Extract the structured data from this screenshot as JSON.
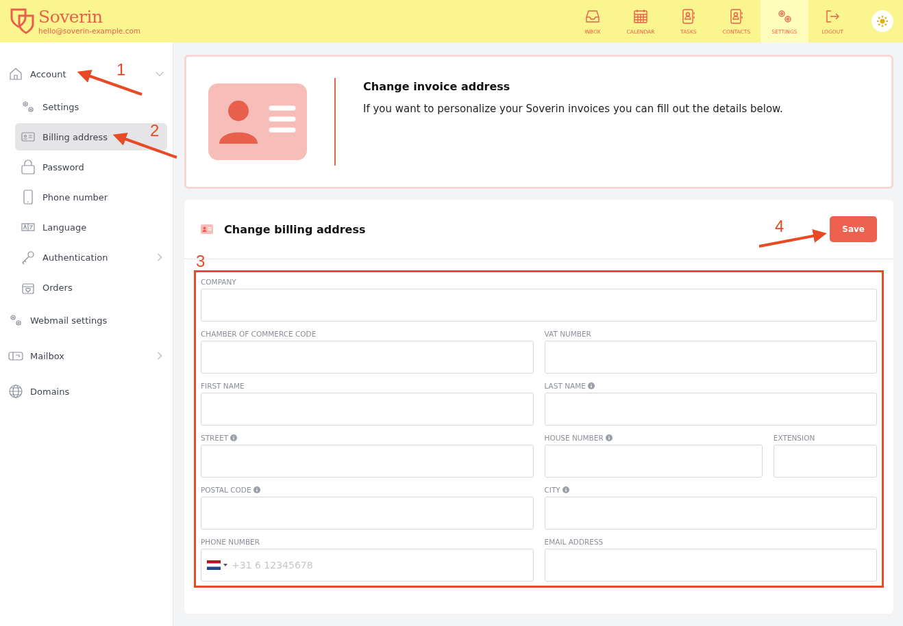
{
  "header": {
    "brand": "Soverin",
    "email": "hello@soverin-example.com",
    "nav": [
      {
        "label": "INBOX",
        "selected": false
      },
      {
        "label": "CALENDAR",
        "selected": false
      },
      {
        "label": "TASKS",
        "selected": false
      },
      {
        "label": "CONTACTS",
        "selected": false
      },
      {
        "label": "SETTINGS",
        "selected": true
      },
      {
        "label": "LOGOUT",
        "selected": false
      }
    ]
  },
  "sidebar": {
    "items": [
      {
        "label": "Account",
        "selected": false,
        "expanded": true,
        "children": [
          {
            "label": "Settings",
            "selected": false
          },
          {
            "label": "Billing address",
            "selected": true
          },
          {
            "label": "Password",
            "selected": false
          },
          {
            "label": "Phone number",
            "selected": false
          },
          {
            "label": "Language",
            "selected": false
          },
          {
            "label": "Authentication",
            "selected": false,
            "expanded": false
          },
          {
            "label": "Orders",
            "selected": false
          }
        ]
      },
      {
        "label": "Webmail settings",
        "selected": false
      },
      {
        "label": "Mailbox",
        "selected": false,
        "expanded": false
      },
      {
        "label": "Domains",
        "selected": false
      }
    ]
  },
  "intro": {
    "title": "Change invoice address",
    "text": "If you want to personalize your Soverin invoices you can fill out the details below."
  },
  "form": {
    "title": "Change billing address",
    "save": "Save",
    "rows": [
      [
        {
          "label": "COMPANY",
          "info": false,
          "kind": "text"
        }
      ],
      [
        {
          "label": "CHAMBER OF COMMERCE CODE",
          "info": false,
          "kind": "text"
        },
        {
          "label": "VAT NUMBER",
          "info": false,
          "kind": "text"
        }
      ],
      [
        {
          "label": "FIRST NAME",
          "info": false,
          "kind": "text"
        },
        {
          "label": "LAST NAME",
          "info": true,
          "kind": "text"
        }
      ],
      [
        {
          "label": "STREET",
          "info": true,
          "kind": "text"
        },
        {
          "label": "HOUSE NUMBER",
          "info": true,
          "kind": "text"
        },
        {
          "label": "EXTENSION",
          "info": false,
          "kind": "text"
        }
      ],
      [
        {
          "label": "POSTAL CODE",
          "info": true,
          "kind": "text"
        },
        {
          "label": "CITY",
          "info": true,
          "kind": "text"
        }
      ],
      [
        {
          "label": "PHONE NUMBER",
          "info": false,
          "kind": "phone",
          "placeholder": "+31 6 12345678"
        },
        {
          "label": "EMAIL ADDRESS",
          "info": false,
          "kind": "text"
        }
      ]
    ]
  },
  "annotations": [
    {
      "label": "1"
    },
    {
      "label": "2"
    },
    {
      "label": "3"
    },
    {
      "label": "4"
    }
  ]
}
